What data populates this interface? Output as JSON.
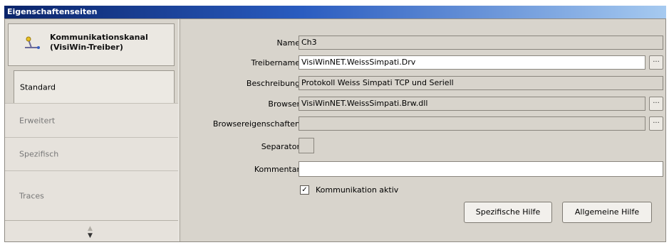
{
  "window": {
    "title": "Eigenschaftenseiten"
  },
  "header": {
    "title_line1": "Kommunikationskanal",
    "title_line2": "(VisiWin-Treiber)",
    "icon": "channel-icon"
  },
  "nav": {
    "items": [
      {
        "label": "Standard",
        "selected": true
      },
      {
        "label": "Erweitert",
        "selected": false
      },
      {
        "label": "Spezifisch",
        "selected": false
      },
      {
        "label": "Traces",
        "selected": false
      }
    ],
    "scroll_up": "▲",
    "scroll_down": "▼"
  },
  "form": {
    "name": {
      "label": "Name",
      "value": "Ch3"
    },
    "treibername": {
      "label": "Treibername",
      "value": "VisiWinNET.WeissSimpati.Drv"
    },
    "beschreibung": {
      "label": "Beschreibung",
      "value": "Protokoll Weiss Simpati TCP und Seriell"
    },
    "browser": {
      "label": "Browser",
      "value": "VisiWinNET.WeissSimpati.Brw.dll"
    },
    "browsereigenschaften": {
      "label": "Browsereigenschaften",
      "value": ""
    },
    "separator": {
      "label": "Separator",
      "value": ""
    },
    "kommentar": {
      "label": "Kommentar",
      "value": ""
    },
    "browse_label": "...",
    "kommunikation": {
      "label": "Kommunikation aktiv",
      "checked": true,
      "mark": "✓"
    }
  },
  "buttons": {
    "spezifische_hilfe": "Spezifische Hilfe",
    "allgemeine_hilfe": "Allgemeine Hilfe"
  },
  "colors": {
    "title_gradient_start": "#0a246a",
    "title_gradient_end": "#a6caf0",
    "dialog_background": "#d8d4cc"
  }
}
